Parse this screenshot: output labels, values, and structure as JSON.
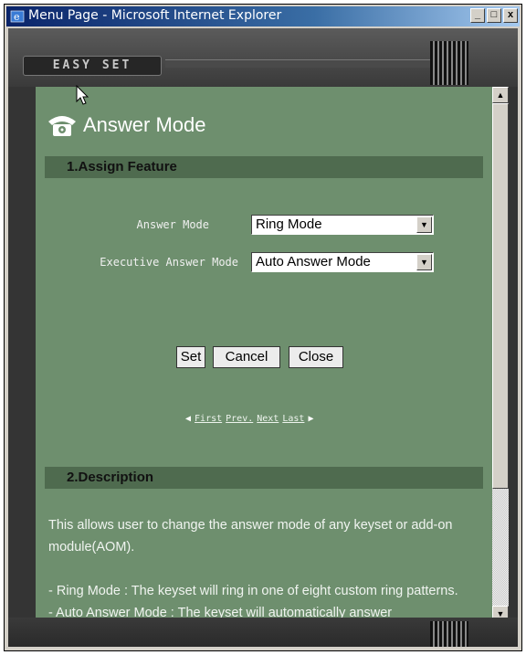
{
  "window": {
    "title": "Menu Page - Microsoft Internet Explorer",
    "minimize": "_",
    "maximize": "□",
    "close": "x"
  },
  "frame": {
    "logo_text": "EASY SET"
  },
  "page": {
    "heading": "Answer Mode"
  },
  "sections": {
    "assign": "1.Assign Feature",
    "description": "2.Description"
  },
  "fields": {
    "answer_mode_label": "Answer Mode",
    "answer_mode_value": "Ring Mode",
    "exec_answer_mode_label": "Executive Answer Mode",
    "exec_answer_mode_value": "Auto Answer Mode"
  },
  "buttons": {
    "set": "Set",
    "cancel": "Cancel",
    "close": "Close"
  },
  "pager": {
    "first": "First",
    "prev": "Prev.",
    "next": "Next",
    "last": "Last"
  },
  "description": {
    "para1": "This allows user to change the answer mode of any keyset or add-on module(AOM).",
    "para2": "- Ring Mode : The keyset will ring in one of eight custom ring patterns.",
    "para3": "- Auto Answer Mode : The keyset will automatically answer"
  }
}
